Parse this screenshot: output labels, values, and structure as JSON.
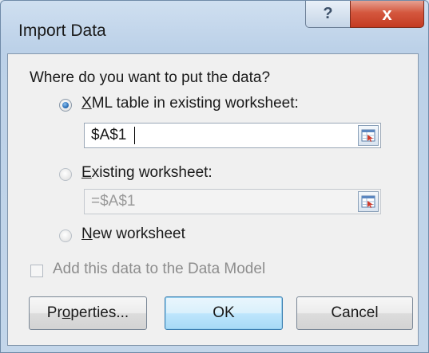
{
  "window": {
    "title": "Import Data",
    "help_glyph": "?",
    "close_glyph": "x"
  },
  "prompt": "Where do you want to put the data?",
  "options": [
    {
      "label_prefix": "",
      "label_mnemonic": "X",
      "label_rest": "ML table in existing worksheet:",
      "selected": true
    },
    {
      "label_prefix": "",
      "label_mnemonic": "E",
      "label_rest": "xisting worksheet:",
      "selected": false
    },
    {
      "label_prefix": "",
      "label_mnemonic": "N",
      "label_rest": "ew worksheet",
      "selected": false
    }
  ],
  "xml_table_ref": "$A$1",
  "existing_ws_ref": "=$A$1",
  "data_model_label": "Add this data to the Data Model",
  "data_model_checked": false,
  "buttons": {
    "properties_prefix": "Pr",
    "properties_mnemonic": "o",
    "properties_rest": "perties...",
    "ok": "OK",
    "cancel": "Cancel"
  },
  "icons": {
    "help": "help-icon",
    "close": "close-icon",
    "ref_picker": "collapse-dialog-icon"
  }
}
